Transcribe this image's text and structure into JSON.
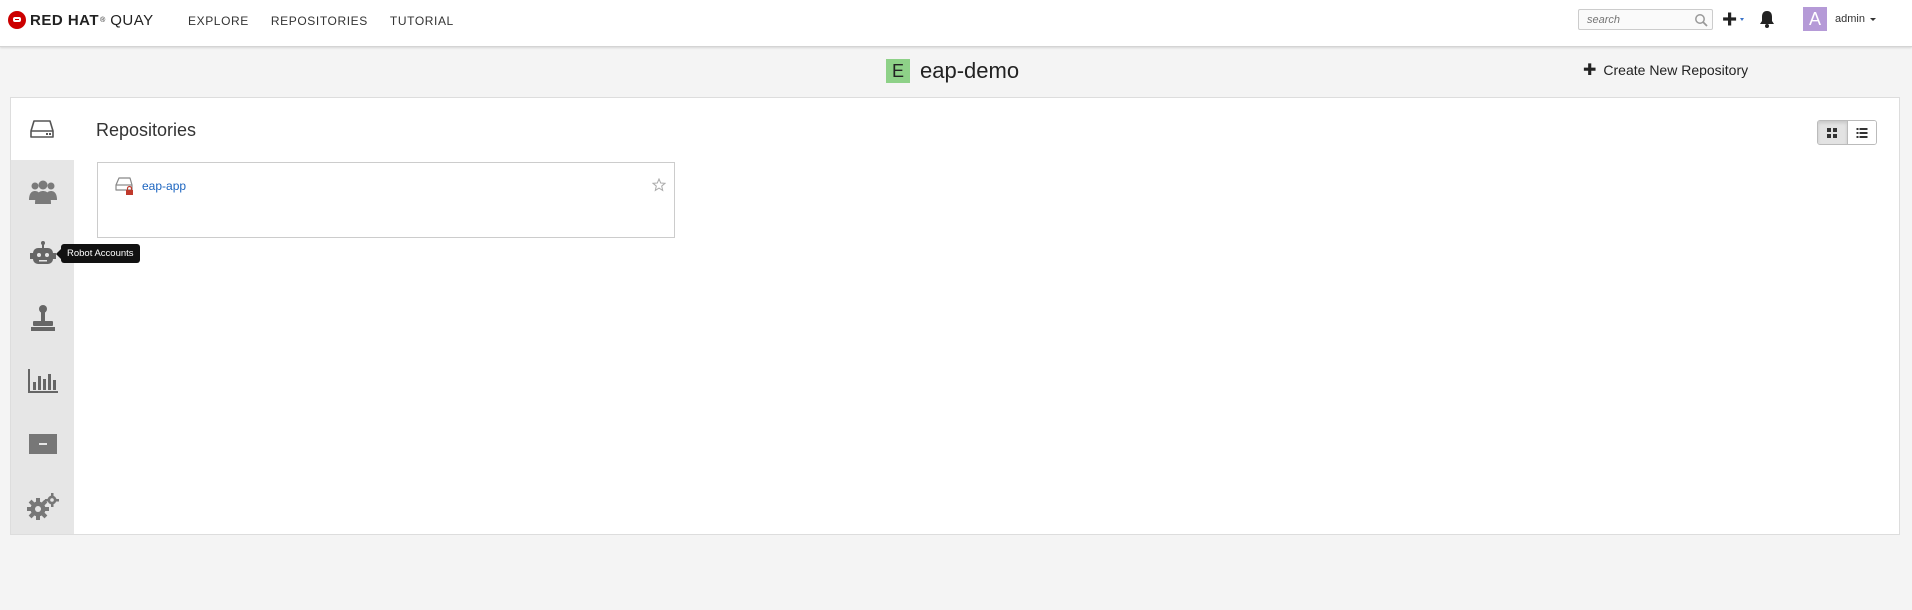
{
  "brand": {
    "red_hat": "RED HAT",
    "trademark": "®",
    "product": "QUAY"
  },
  "nav": {
    "links": [
      {
        "label": "EXPLORE"
      },
      {
        "label": "REPOSITORIES"
      },
      {
        "label": "TUTORIAL"
      }
    ],
    "search_placeholder": "search",
    "user": {
      "avatar_letter": "A",
      "avatar_color": "#b59ad7",
      "name": "admin"
    }
  },
  "org": {
    "avatar_letter": "E",
    "avatar_color": "#8ed188",
    "name": "eap-demo"
  },
  "actions": {
    "create_repo_label": "Create New Repository"
  },
  "sidebar": {
    "tabs": [
      {
        "icon": "repository-icon",
        "active": true
      },
      {
        "icon": "teams-icon"
      },
      {
        "icon": "robot-icon"
      },
      {
        "icon": "default-permissions-icon"
      },
      {
        "icon": "usage-logs-icon"
      },
      {
        "icon": "applications-icon"
      },
      {
        "icon": "settings-gears-icon"
      }
    ],
    "tooltip": "Robot Accounts"
  },
  "main": {
    "title": "Repositories",
    "view_modes": [
      {
        "icon": "grid-view-icon",
        "active": true
      },
      {
        "icon": "list-view-icon"
      }
    ],
    "repositories": [
      {
        "name": "eap-app",
        "private": true,
        "starred": false
      }
    ]
  },
  "colors": {
    "link": "#1c65c0",
    "brand_red": "#cc0000",
    "sidebar_bg": "#e6e6e6"
  }
}
